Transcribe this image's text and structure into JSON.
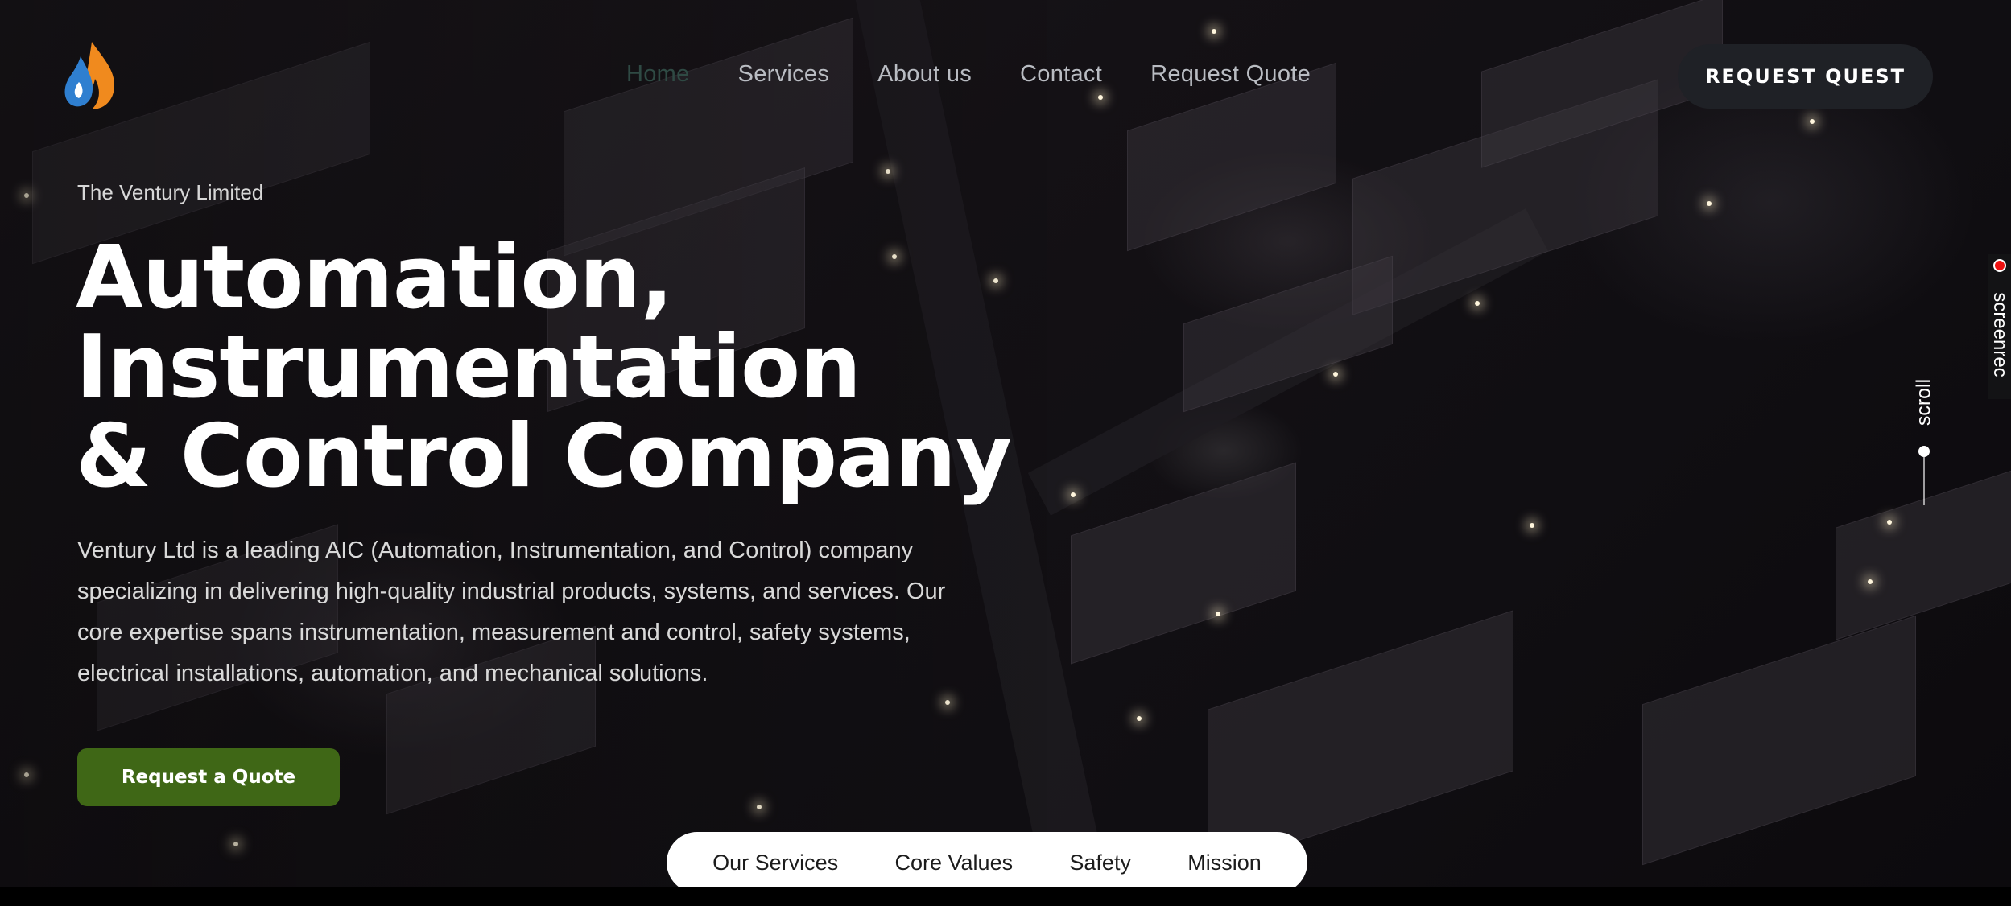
{
  "nav": {
    "items": [
      {
        "label": "Home",
        "active": true
      },
      {
        "label": "Services"
      },
      {
        "label": "About us"
      },
      {
        "label": "Contact"
      },
      {
        "label": "Request Quote"
      }
    ],
    "quest_button": "REQUEST QUEST"
  },
  "hero": {
    "eyebrow": "The Ventury Limited",
    "headline": [
      "Automation,",
      "Instrumentation",
      "& Control Company"
    ],
    "description": "Ventury Ltd is a leading AIC (Automation, Instrumentation, and Control) company specializing in delivering high-quality industrial products, systems, and services. Our core expertise spans instrumentation, measurement and control, safety systems, electrical installations, automation, and mechanical solutions.",
    "cta": "Request a Quote"
  },
  "section_nav": [
    "Our Services",
    "Core Values",
    "Safety",
    "Mission"
  ],
  "scroll_label": "scroll",
  "recorder_label": "screenrec",
  "colors": {
    "cta_green": "#3f6716",
    "quest_bg": "#1f2126",
    "logo_blue": "#2f7fd0",
    "logo_orange": "#f08a1e"
  },
  "icons": {
    "logo": "flame-drop-logo",
    "scroll": "scroll-indicator",
    "recorder": "record-dot-icon"
  }
}
